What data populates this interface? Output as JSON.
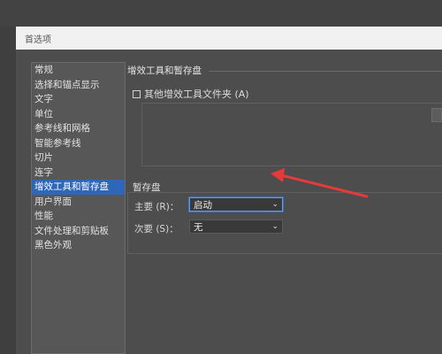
{
  "dialog": {
    "title": "首选项"
  },
  "sidebar": {
    "items": [
      {
        "label": "常规"
      },
      {
        "label": "选择和锚点显示"
      },
      {
        "label": "文字"
      },
      {
        "label": "单位"
      },
      {
        "label": "参考线和网格"
      },
      {
        "label": "智能参考线"
      },
      {
        "label": "切片"
      },
      {
        "label": "连字"
      },
      {
        "label": "增效工具和暂存盘",
        "selected": true
      },
      {
        "label": "用户界面"
      },
      {
        "label": "性能"
      },
      {
        "label": "文件处理和剪贴板"
      },
      {
        "label": "黑色外观"
      }
    ]
  },
  "panel": {
    "section_title": "增效工具和暂存盘",
    "plugins_checkbox_label": "其他增效工具文件夹 (A)",
    "plugins_checked": false,
    "scratch_title": "暂存盘",
    "primary_label": "主要 (R)：",
    "primary_value": "启动",
    "secondary_label": "次要 (S)：",
    "secondary_value": "无"
  },
  "annotation": {
    "arrow_color": "#e53a3a"
  }
}
